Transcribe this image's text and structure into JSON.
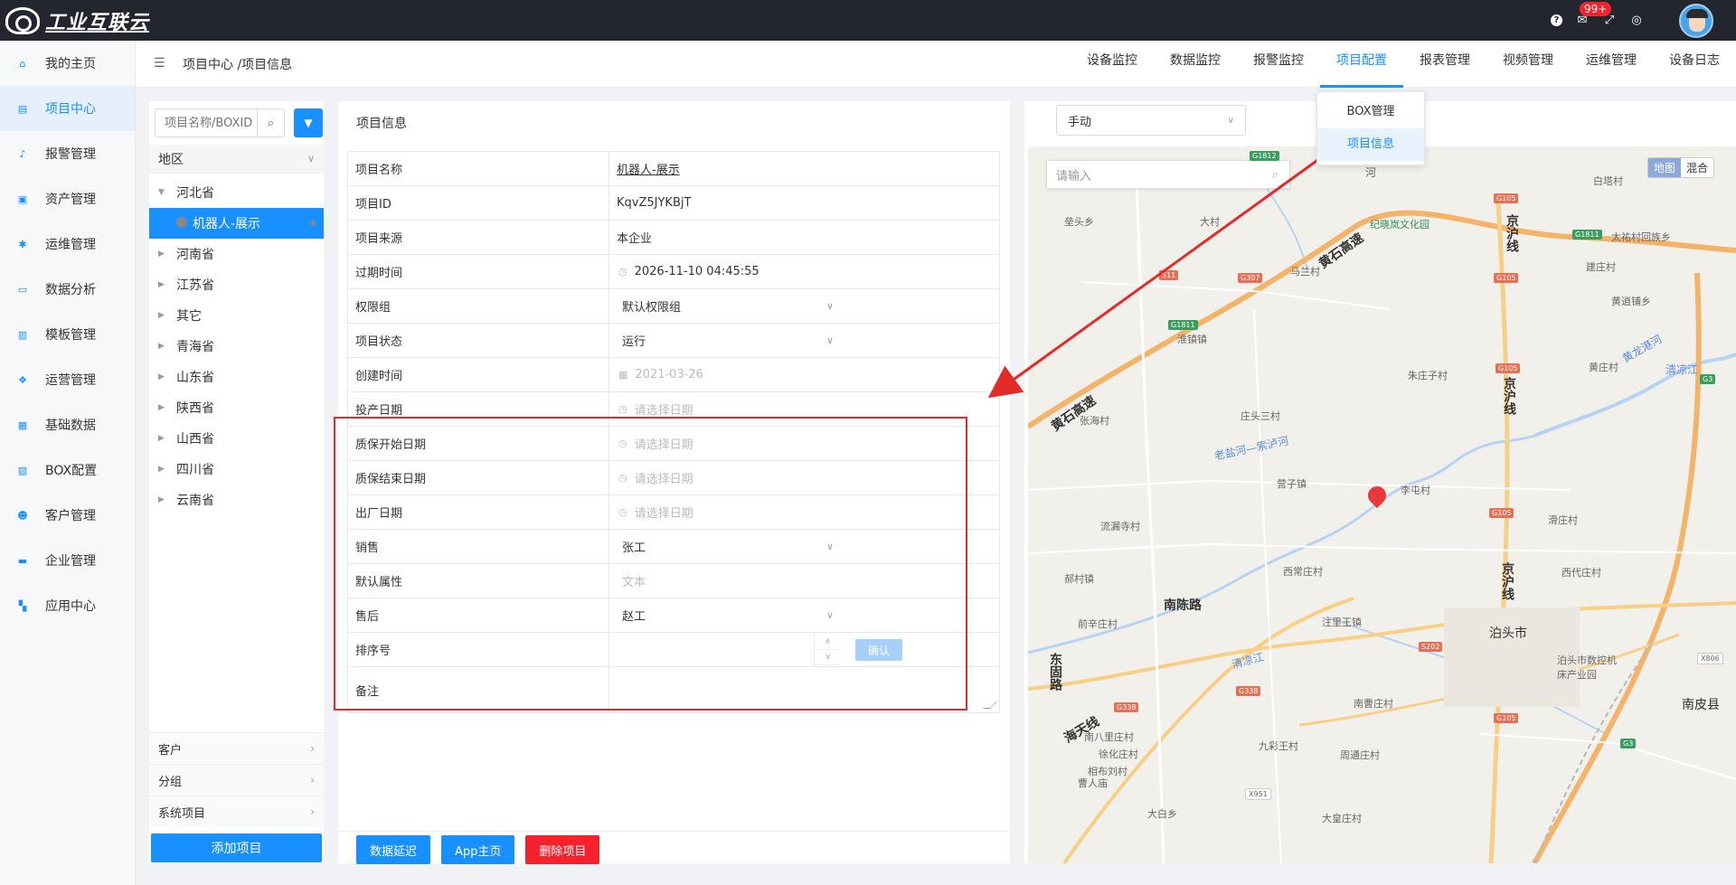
{
  "app": {
    "logo_text": "工业互联云",
    "notification_badge": "99+"
  },
  "sidebar": {
    "items": [
      {
        "label": "我的主页",
        "icon": "home-icon",
        "active": false
      },
      {
        "label": "项目中心",
        "icon": "project-icon",
        "active": true
      },
      {
        "label": "报警管理",
        "icon": "bell-icon",
        "active": false
      },
      {
        "label": "资产管理",
        "icon": "asset-icon",
        "active": false
      },
      {
        "label": "运维管理",
        "icon": "gear-icon",
        "active": false
      },
      {
        "label": "数据分析",
        "icon": "monitor-icon",
        "active": false
      },
      {
        "label": "模板管理",
        "icon": "template-icon",
        "active": false
      },
      {
        "label": "运营管理",
        "icon": "operation-icon",
        "active": false
      },
      {
        "label": "基础数据",
        "icon": "database-icon",
        "active": false
      },
      {
        "label": "BOX配置",
        "icon": "box-icon",
        "active": false
      },
      {
        "label": "客户管理",
        "icon": "users-icon",
        "active": false
      },
      {
        "label": "企业管理",
        "icon": "briefcase-icon",
        "active": false
      },
      {
        "label": "应用中心",
        "icon": "apps-icon",
        "active": false
      }
    ]
  },
  "header": {
    "breadcrumb": "项目中心 /项目信息",
    "nav": [
      {
        "label": "设备监控",
        "active": false
      },
      {
        "label": "数据监控",
        "active": false
      },
      {
        "label": "报警监控",
        "active": false
      },
      {
        "label": "项目配置",
        "active": true
      },
      {
        "label": "报表管理",
        "active": false
      },
      {
        "label": "视频管理",
        "active": false
      },
      {
        "label": "运维管理",
        "active": false
      },
      {
        "label": "设备日志",
        "active": false
      }
    ],
    "dropdown": [
      {
        "label": "BOX管理",
        "selected": false
      },
      {
        "label": "项目信息",
        "selected": true
      }
    ]
  },
  "tree": {
    "search_placeholder": "项目名称/BOXID",
    "region_label": "地区",
    "nodes": [
      {
        "label": "河北省",
        "expanded": true
      },
      {
        "label": "机器人-展示",
        "selected": true
      },
      {
        "label": "河南省"
      },
      {
        "label": "江苏省"
      },
      {
        "label": "其它"
      },
      {
        "label": "青海省"
      },
      {
        "label": "山东省"
      },
      {
        "label": "陕西省"
      },
      {
        "label": "山西省"
      },
      {
        "label": "四川省"
      },
      {
        "label": "云南省"
      }
    ],
    "groups": [
      "客户",
      "分组",
      "系统项目"
    ],
    "add_button": "添加项目"
  },
  "info": {
    "title": "项目信息",
    "fields": [
      {
        "label": "项目名称",
        "value": "机器人-展示",
        "kind": "link"
      },
      {
        "label": "项目ID",
        "value": "KqvZ5JYKBjT",
        "kind": "text"
      },
      {
        "label": "项目来源",
        "value": "本企业",
        "kind": "text"
      },
      {
        "label": "过期时间",
        "value": "2026-11-10 04:45:55",
        "kind": "datetime"
      },
      {
        "label": "权限组",
        "value": "默认权限组",
        "kind": "select"
      },
      {
        "label": "项目状态",
        "value": "运行",
        "kind": "select"
      },
      {
        "label": "创建时间",
        "value": "2021-03-26",
        "kind": "date-disabled"
      },
      {
        "label": "投产日期",
        "value": "请选择日期",
        "kind": "date-ph"
      },
      {
        "label": "质保开始日期",
        "value": "请选择日期",
        "kind": "date-ph"
      },
      {
        "label": "质保结束日期",
        "value": "请选择日期",
        "kind": "date-ph"
      },
      {
        "label": "出厂日期",
        "value": "请选择日期",
        "kind": "date-ph"
      },
      {
        "label": "销售",
        "value": "张工",
        "kind": "select"
      },
      {
        "label": "默认属性",
        "value": "文本",
        "kind": "ph"
      },
      {
        "label": "售后",
        "value": "赵工",
        "kind": "select"
      },
      {
        "label": "排序号",
        "value": "",
        "kind": "number"
      },
      {
        "label": "备注",
        "value": "",
        "kind": "textarea"
      }
    ],
    "confirm_label": "确认",
    "actions": [
      {
        "label": "数据延迟",
        "color": "#1890ff"
      },
      {
        "label": "App主页",
        "color": "#1890ff"
      },
      {
        "label": "删除项目",
        "color": "#f5222d"
      }
    ]
  },
  "map": {
    "mode": "手动",
    "search_placeholder": "请输入",
    "toggle": [
      {
        "label": "地图",
        "on": true
      },
      {
        "label": "混合",
        "on": false
      }
    ],
    "labels": {
      "l1": "纪晓岚文化园",
      "l2": "京沪线",
      "l3": "黄石高速",
      "l4": "黄石高速",
      "l5": "大村",
      "l6": "垒头乡",
      "l7": "马兰村",
      "l8": "淮镇镇",
      "l9": "张海村",
      "l10": "庄头三村",
      "l11": "老盐河—索泸河",
      "l12": "营子镇",
      "l13": "李屯村",
      "l14": "流漏寺村",
      "l15": "郝村镇",
      "l16": "南陈路",
      "l17": "西常庄村",
      "l18": "注里王镇",
      "l19": "泊头市",
      "l20": "泊头市数控机床产业园",
      "l21": "东固路",
      "l22": "清凉江",
      "l23": "海天线",
      "l24": "南曹庄村",
      "l25": "南八里庄村",
      "l26": "徐化庄村",
      "l27": "九彩王村",
      "l28": "周通庄村",
      "l29": "相布刘村",
      "l30": "曹人庙",
      "l31": "大白乡",
      "l32": "大皇庄村",
      "l33": "南皮县",
      "l34": "白塔村",
      "l35": "太祐村回族乡",
      "l36": "建庄村",
      "l37": "黄逍铺乡",
      "l38": "黄龙港河",
      "l39": "黄庄村",
      "l40": "清凉江",
      "l41": "朱庄子村",
      "l42": "滑庄村",
      "l43": "西代庄村",
      "l44": "前辛庄村",
      "l45": "河",
      "l46": "京沪线",
      "l47": "京沪线"
    },
    "shields": {
      "s1": "G1812",
      "s2": "G105",
      "s3": "G1811",
      "s4": "G105",
      "s5": "S11",
      "s6": "G307",
      "s7": "G1811",
      "s8": "G105",
      "s9": "G3",
      "s10": "G105",
      "s11": "S202",
      "s12": "G338",
      "s13": "G338",
      "s14": "G105",
      "s15": "G3",
      "s16": "X806",
      "s17": "X951"
    }
  }
}
